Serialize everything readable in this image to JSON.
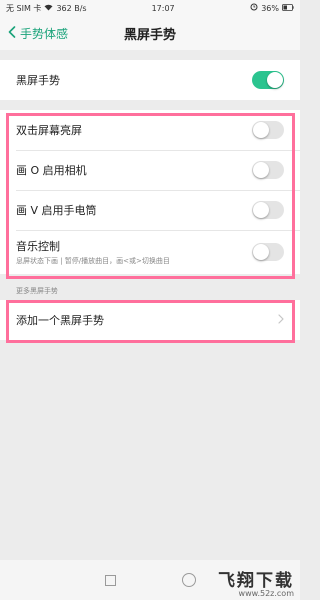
{
  "status_bar": {
    "carrier": "无 SIM 卡",
    "speed": "362 B/s",
    "time": "17:07",
    "battery": "36%"
  },
  "header": {
    "back_label": "手势体感",
    "title": "黑屏手势"
  },
  "master": {
    "label": "黑屏手势",
    "enabled": true
  },
  "gestures": [
    {
      "label": "双击屏幕亮屏",
      "subtitle": "",
      "enabled": false
    },
    {
      "label": "画 O 启用相机",
      "subtitle": "",
      "enabled": false
    },
    {
      "label": "画 V 启用手电筒",
      "subtitle": "",
      "enabled": false
    },
    {
      "label": "音乐控制",
      "subtitle": "息屏状态下画 | 暂停/播放曲目，画<或>切换曲目",
      "enabled": false
    }
  ],
  "more_section": {
    "label": "更多黑屏手势",
    "add_label": "添加一个黑屏手势"
  },
  "watermark": {
    "main": "飞翔下载",
    "sub": "www.52z.com"
  },
  "colors": {
    "accent": "#2bc48f",
    "back_link": "#1aa37a",
    "highlight": "#ff6f9c"
  }
}
